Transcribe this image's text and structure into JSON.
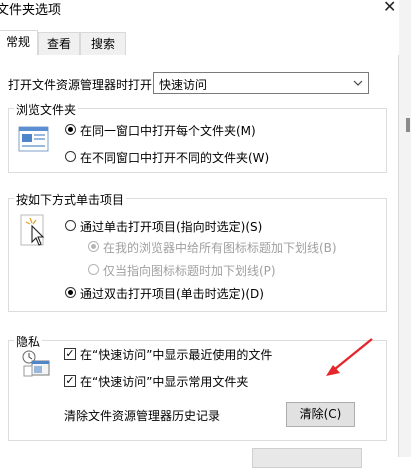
{
  "window": {
    "title": "文件夹选项"
  },
  "tabs": [
    "常规",
    "查看",
    "搜索"
  ],
  "open_explorer": {
    "label": "打开文件资源管理器时打开:",
    "value": "快速访问"
  },
  "browse": {
    "title": "浏览文件夹",
    "options": [
      "在同一窗口中打开每个文件夹(M)",
      "在不同窗口中打开不同的文件夹(W)"
    ],
    "selected_index": 0
  },
  "click": {
    "title": "按如下方式单击项目",
    "single": "通过单击打开项目(指向时选定)(S)",
    "sub_options": [
      "在我的浏览器中给所有图标标题加下划线(B)",
      "仅当指向图标标题时加下划线(P)"
    ],
    "double": "通过双击打开项目(单击时选定)(D)",
    "selected": "double"
  },
  "privacy": {
    "title": "隐私",
    "recent_files": "在“快速访问”中显示最近使用的文件",
    "frequent_folders": "在“快速访问”中显示常用文件夹",
    "clear_label": "清除文件资源管理器历史记录",
    "clear_button": "清除(C)",
    "recent_files_checked": true,
    "frequent_folders_checked": true
  },
  "colors": {
    "arrow": "#e5262a",
    "tab_border": "#d9d9d9"
  },
  "icons": [
    "close-icon",
    "folder-window-icon",
    "cursor-click-icon",
    "privacy-icon",
    "chevron-down-icon"
  ]
}
